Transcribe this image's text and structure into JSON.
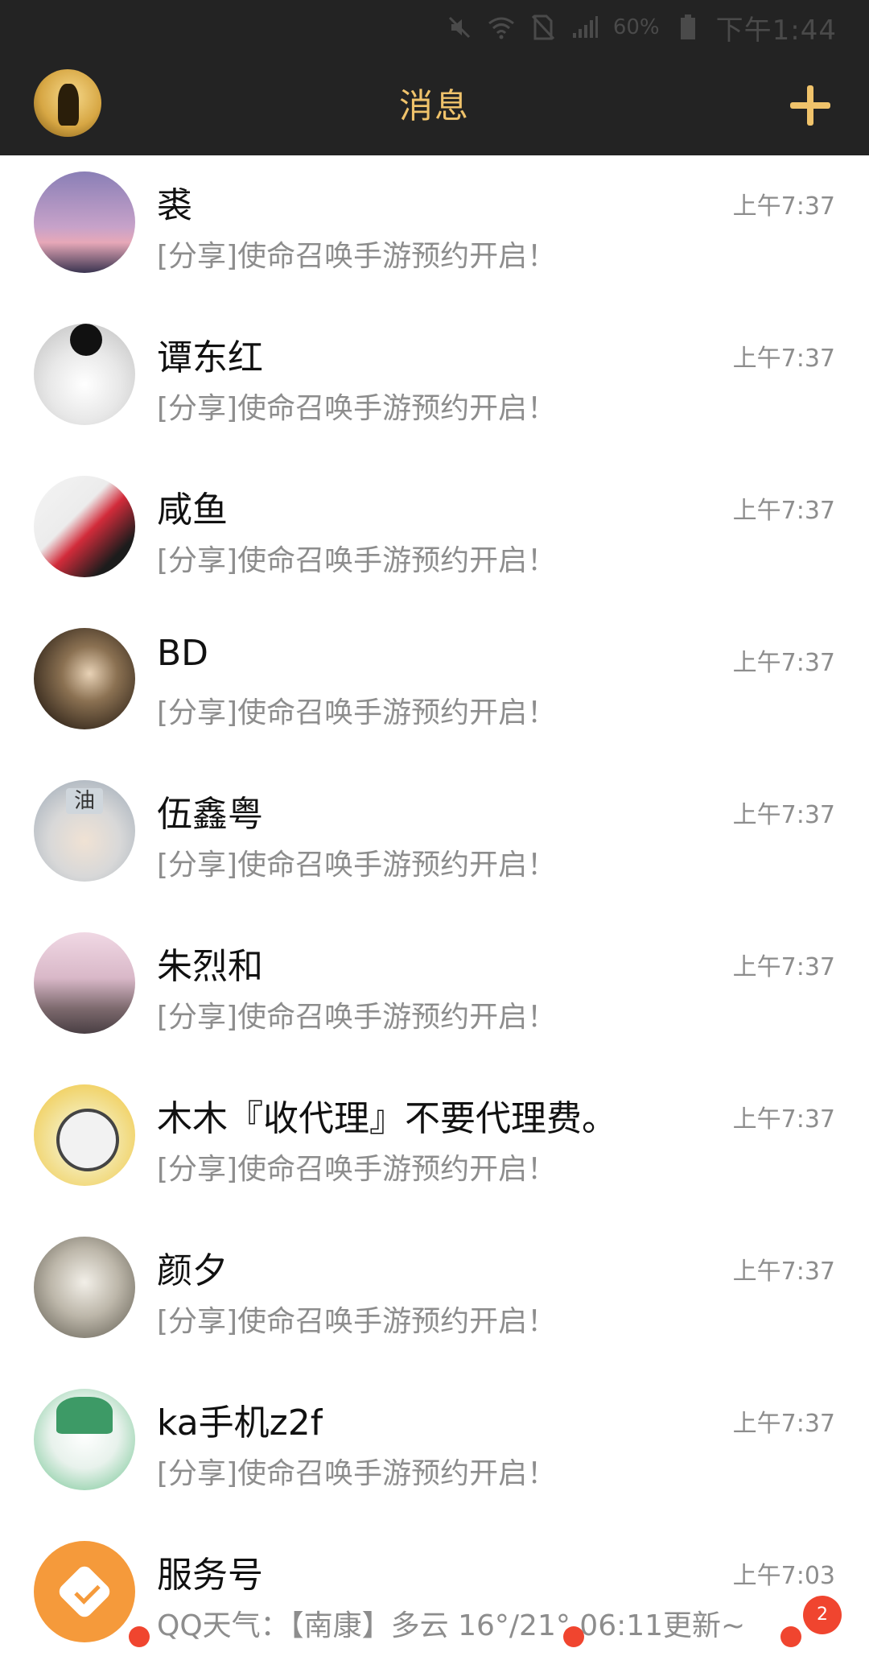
{
  "status_bar": {
    "battery": "60%",
    "time": "下午1:44",
    "icons": [
      "mute-icon",
      "wifi-icon",
      "no-sim-icon",
      "signal-icon",
      "battery-icon"
    ]
  },
  "nav": {
    "title": "消息",
    "add_icon": "plus-icon"
  },
  "conversations": [
    {
      "name": "裘",
      "preview": "[分享]使命召唤手游预约开启！",
      "time": "上午7:37"
    },
    {
      "name": "谭东红",
      "preview": "[分享]使命召唤手游预约开启！",
      "time": "上午7:37"
    },
    {
      "name": "咸鱼",
      "preview": "[分享]使命召唤手游预约开启！",
      "time": "上午7:37"
    },
    {
      "name": "BD",
      "preview": "[分享]使命召唤手游预约开启！",
      "time": "上午7:37"
    },
    {
      "name": "伍鑫粤",
      "preview": "[分享]使命召唤手游预约开启！",
      "time": "上午7:37"
    },
    {
      "name": "朱烈和",
      "preview": "[分享]使命召唤手游预约开启！",
      "time": "上午7:37"
    },
    {
      "name": "木木『收代理』不要代理费。",
      "preview": "[分享]使命召唤手游预约开启！",
      "time": "上午7:37"
    },
    {
      "name": "颜夕",
      "preview": "[分享]使命召唤手游预约开启！",
      "time": "上午7:37"
    },
    {
      "name": "ka手机z2f",
      "preview": "[分享]使命召唤手游预约开启！",
      "time": "上午7:37"
    },
    {
      "name": "服务号",
      "preview": "QQ天气：【南康】多云 16°/21° 06:11更新~",
      "time": "上午7:03"
    }
  ],
  "badge": {
    "count": "2"
  },
  "colors": {
    "header_bg": "#232323",
    "accent": "#f0c36b",
    "badge": "#f0452f"
  }
}
